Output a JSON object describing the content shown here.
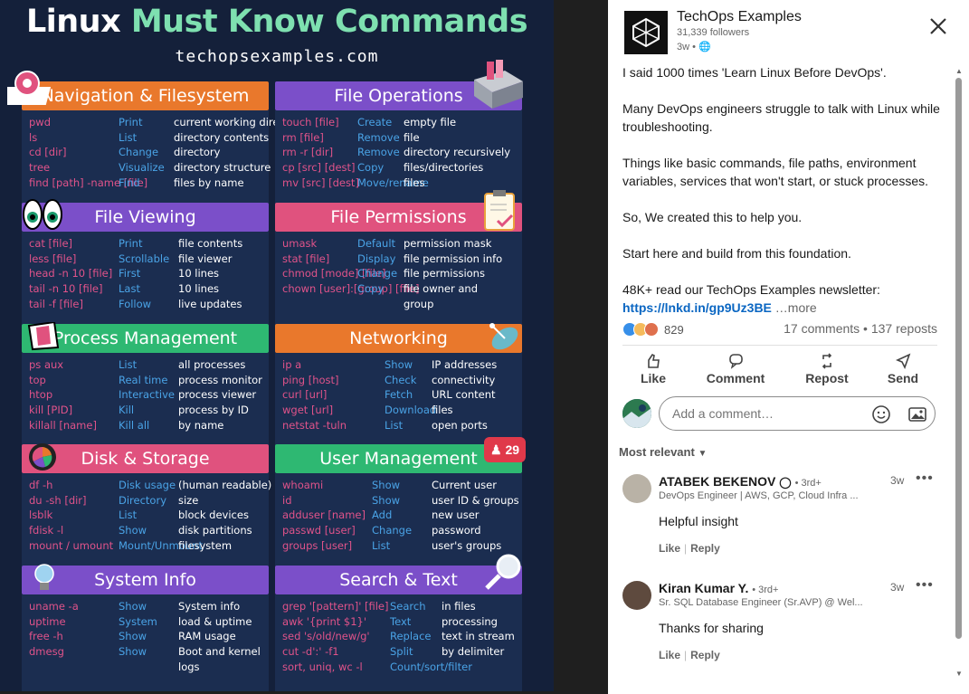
{
  "infographic": {
    "title_part1": "Linux ",
    "title_part2": "Must Know Commands",
    "site": "techopsexamples.com",
    "sections": [
      {
        "title": "Navigation & Filesystem",
        "color": "#e9782c",
        "rows": [
          [
            "pwd",
            "Print",
            "current working directory"
          ],
          [
            "ls",
            "List",
            "directory contents"
          ],
          [
            "cd [dir]",
            "Change",
            "directory"
          ],
          [
            "tree",
            "Visualize",
            "directory structure"
          ],
          [
            "find [path] -name [file]",
            "Find",
            "files by name"
          ]
        ]
      },
      {
        "title": "File Operations",
        "color": "#7b4fc9",
        "rows": [
          [
            "touch [file]",
            "Create",
            "empty file"
          ],
          [
            "rm [file]",
            "Remove",
            "file"
          ],
          [
            "rm -r [dir]",
            "Remove",
            "directory recursively"
          ],
          [
            "cp [src] [dest]",
            "Copy",
            "files/directories"
          ],
          [
            "mv [src] [dest]",
            "Move/rename",
            "files"
          ]
        ]
      },
      {
        "title": "File Viewing",
        "color": "#7b4fc9",
        "rows": [
          [
            "cat [file]",
            "Print",
            "file contents"
          ],
          [
            "less [file]",
            "Scrollable",
            "file viewer"
          ],
          [
            "head -n 10 [file]",
            "First",
            "10 lines"
          ],
          [
            "tail -n 10 [file]",
            "Last",
            "10 lines"
          ],
          [
            "tail -f [file]",
            "Follow",
            "live updates"
          ]
        ]
      },
      {
        "title": "File Permissions",
        "color": "#e0527e",
        "rows": [
          [
            "umask",
            "Default",
            "permission mask"
          ],
          [
            "stat [file]",
            "Display",
            "file permission info"
          ],
          [
            "chmod [mode] [file]",
            "Change",
            "file permissions"
          ],
          [
            "chown [user]:[group] [file]",
            "Copy",
            "file owner and"
          ],
          [
            "",
            "",
            "group"
          ]
        ]
      },
      {
        "title": "Process Management",
        "color": "#2eb872",
        "rows": [
          [
            "ps aux",
            "List",
            "all processes"
          ],
          [
            "top",
            "Real time",
            "process monitor"
          ],
          [
            "htop",
            "Interactive",
            "process viewer"
          ],
          [
            "kill [PID]",
            "Kill",
            "process by ID"
          ],
          [
            "killall [name]",
            "Kill all",
            "by name"
          ]
        ]
      },
      {
        "title": "Networking",
        "color": "#e9782c",
        "rows": [
          [
            "ip a",
            "Show",
            "IP addresses"
          ],
          [
            "ping [host]",
            "Check",
            "connectivity"
          ],
          [
            "curl [url]",
            "Fetch",
            "URL content"
          ],
          [
            "wget [url]",
            "Download",
            "files"
          ],
          [
            "netstat -tuln",
            "List",
            "open ports"
          ]
        ]
      },
      {
        "title": "Disk & Storage",
        "color": "#e0527e",
        "rows": [
          [
            "df -h",
            "Disk usage",
            "(human readable)"
          ],
          [
            "du -sh [dir]",
            "Directory",
            "size"
          ],
          [
            "lsblk",
            "List",
            "block devices"
          ],
          [
            "fdisk -l",
            "Show",
            "disk partitions"
          ],
          [
            "mount / umount",
            "Mount/Unmount",
            "filesystem"
          ]
        ]
      },
      {
        "title": "User Management",
        "color": "#2eb872",
        "rows": [
          [
            "whoami",
            "Show",
            "Current user"
          ],
          [
            "id",
            "Show",
            "user ID & groups"
          ],
          [
            "adduser [name]",
            "Add",
            "new user"
          ],
          [
            "passwd [user]",
            "Change",
            "password"
          ],
          [
            "groups [user]",
            "List",
            "user's groups"
          ]
        ]
      },
      {
        "title": "System Info",
        "color": "#7b4fc9",
        "rows": [
          [
            "uname -a",
            "Show",
            "System info"
          ],
          [
            "uptime",
            "System",
            "load & uptime"
          ],
          [
            "free -h",
            "Show",
            "RAM usage"
          ],
          [
            "dmesg",
            "Show",
            "Boot and kernel"
          ],
          [
            "",
            "",
            "logs"
          ]
        ]
      },
      {
        "title": "Search & Text",
        "color": "#7b4fc9",
        "rows": [
          [
            "grep '[pattern]' [file]",
            "Search",
            "in files"
          ],
          [
            "awk '{print $1}'",
            "Text",
            "processing"
          ],
          [
            "sed 's/old/new/g'",
            "Replace",
            "text in stream"
          ],
          [
            "cut -d':' -f1",
            "Split",
            "by delimiter"
          ],
          [
            "sort, uniq, wc -l",
            "Count/sort/filter",
            ""
          ]
        ]
      }
    ],
    "badge_count": "29"
  },
  "post": {
    "author": "TechOps Examples",
    "followers": "31,339 followers",
    "time": "3w •",
    "paragraphs": [
      "I said 1000 times 'Learn Linux Before DevOps'.",
      "Many DevOps engineers struggle to talk with Linux while troubleshooting.",
      "Things like basic commands, file paths, environment variables, services that won't start, or stuck processes.",
      "So, We created this to help you.",
      "Start here and build from this foundation."
    ],
    "newsletter_text": "48K+ read our TechOps Examples newsletter: ",
    "newsletter_link": "https://lnkd.in/gp9Uz3BE",
    "more": "…more",
    "reaction_count": "829",
    "comments_reposts": "17 comments • 137 reposts",
    "actions": {
      "like": "Like",
      "comment": "Comment",
      "repost": "Repost",
      "send": "Send"
    },
    "comment_placeholder": "Add a comment…",
    "sort_label": "Most relevant"
  },
  "comments": [
    {
      "name": "ATABEK BEKENOV",
      "degree": "• 3rd+",
      "headline": "DevOps Engineer | AWS, GCP, Cloud Infra ...",
      "time": "3w",
      "text": "Helpful insight",
      "like": "Like",
      "reply": "Reply"
    },
    {
      "name": "Kiran Kumar Y.",
      "degree": "• 3rd+",
      "headline": "Sr. SQL Database Engineer (Sr.AVP) @ Wel...",
      "time": "3w",
      "text": "Thanks for sharing",
      "like": "Like",
      "reply": "Reply"
    }
  ],
  "colors": {
    "link": "#0a66c2",
    "card_bg": "#1b2d50",
    "page_bg": "#14203a",
    "cmd": "#e0538a",
    "verb": "#4aa3e6"
  }
}
